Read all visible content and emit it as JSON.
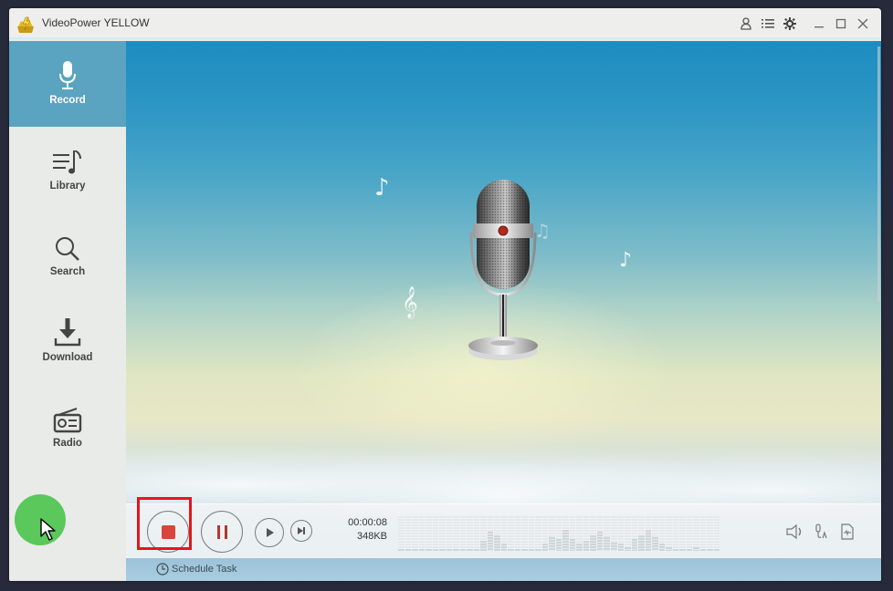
{
  "window": {
    "title": "VideoPower YELLOW",
    "titlebar_icons": [
      "user-icon",
      "list-menu-icon",
      "gear-icon",
      "minimize-icon",
      "maximize-icon",
      "close-icon"
    ]
  },
  "sidebar": {
    "items": [
      {
        "label": "Record",
        "icon": "microphone-icon",
        "active": true
      },
      {
        "label": "Library",
        "icon": "music-library-icon",
        "active": false
      },
      {
        "label": "Search",
        "icon": "search-icon",
        "active": false
      },
      {
        "label": "Download",
        "icon": "download-icon",
        "active": false
      },
      {
        "label": "Radio",
        "icon": "radio-icon",
        "active": false
      }
    ]
  },
  "player": {
    "elapsed": "00:00:08",
    "size": "348KB",
    "buttons": [
      "stop",
      "pause",
      "play",
      "next"
    ],
    "spectrum_levels": [
      0.05,
      0.05,
      0.05,
      0.05,
      0.05,
      0.05,
      0.05,
      0.05,
      0.05,
      0.05,
      0.05,
      0.05,
      0.3,
      0.55,
      0.45,
      0.2,
      0.05,
      0.05,
      0.05,
      0.05,
      0.05,
      0.2,
      0.4,
      0.35,
      0.6,
      0.35,
      0.2,
      0.3,
      0.45,
      0.55,
      0.4,
      0.25,
      0.2,
      0.1,
      0.35,
      0.45,
      0.6,
      0.4,
      0.2,
      0.1,
      0.05,
      0.05,
      0.05,
      0.1,
      0.05,
      0.05,
      0.05
    ],
    "right_icons": [
      "speaker-icon",
      "mic-input-icon",
      "audio-file-icon"
    ]
  },
  "footer": {
    "schedule_label": "Schedule Task"
  },
  "colors": {
    "accent": "#5aa3c1",
    "stop_red": "#d9453b",
    "highlight_red": "#e8141b",
    "cursor_green": "#5ac85a"
  }
}
